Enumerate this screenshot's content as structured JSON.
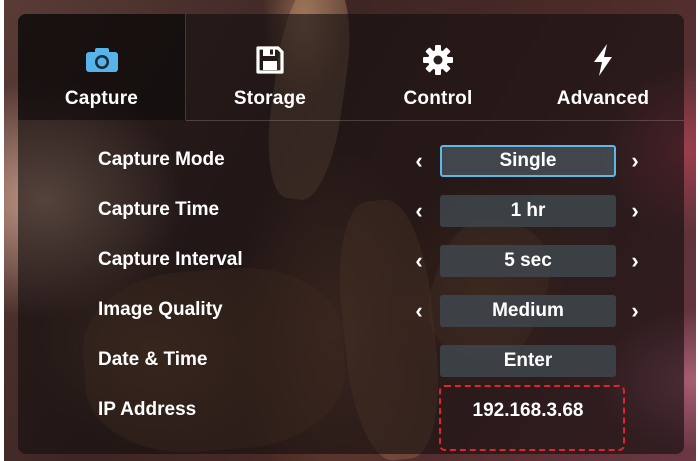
{
  "tabs": [
    {
      "label": "Capture",
      "icon": "camera-icon",
      "active": true
    },
    {
      "label": "Storage",
      "icon": "floppy-disk-icon",
      "active": false
    },
    {
      "label": "Control",
      "icon": "gear-icon",
      "active": false
    },
    {
      "label": "Advanced",
      "icon": "lightning-icon",
      "active": false
    }
  ],
  "settings": [
    {
      "label": "Capture Mode",
      "value": "Single"
    },
    {
      "label": "Capture Time",
      "value": "1 hr"
    },
    {
      "label": "Capture Interval",
      "value": "5 sec"
    },
    {
      "label": "Image Quality",
      "value": "Medium"
    },
    {
      "label": "Date & Time",
      "value": "Enter"
    },
    {
      "label": "IP Address",
      "value": "192.168.3.68"
    }
  ],
  "arrows": {
    "left": "‹",
    "right": "›"
  },
  "colors": {
    "accent": "#5fb6e8",
    "highlight": "#e0242a",
    "field": "#3e464c"
  }
}
